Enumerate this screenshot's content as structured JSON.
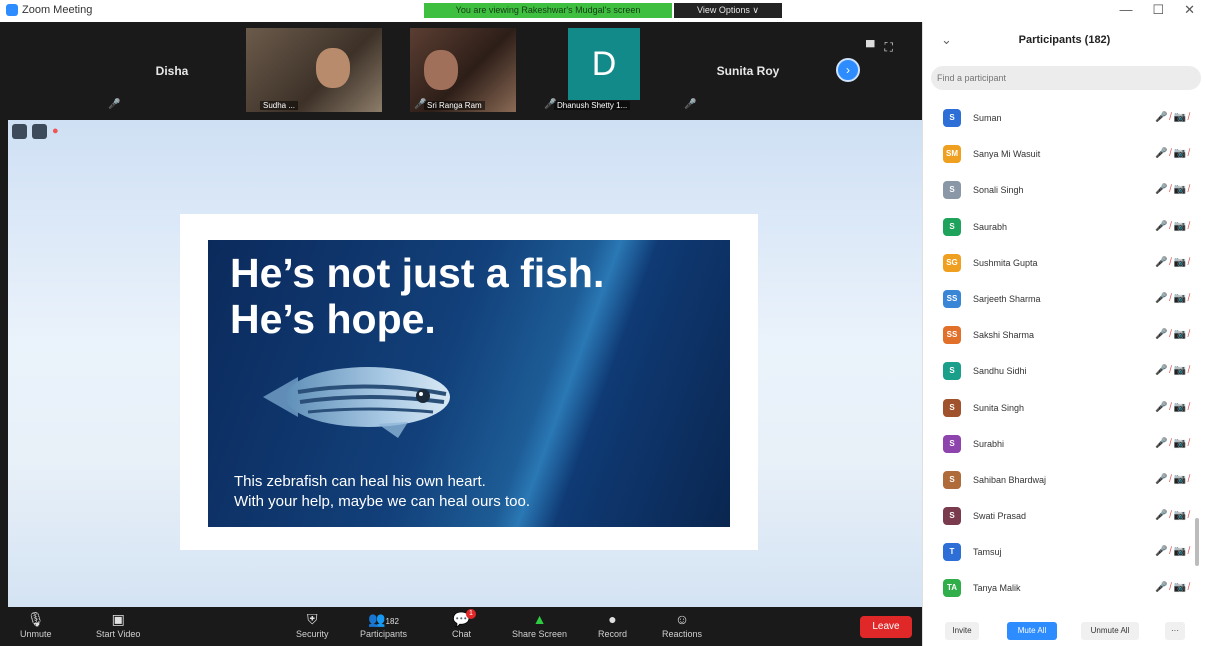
{
  "titlebar": {
    "app_title": "Zoom Meeting",
    "recording_banner": "You are viewing Rakeshwar's Mudgal's screen",
    "view_options": "View Options ∨",
    "window_controls": [
      "—",
      "☐",
      "✕"
    ]
  },
  "gallery": [
    {
      "name": "Disha",
      "type": "name"
    },
    {
      "name": "Sudha ... ",
      "type": "video"
    },
    {
      "name": "Sri Ranga Ram",
      "type": "video"
    },
    {
      "name": "Dhanush Shetty 1...",
      "type": "avatar",
      "initial": "D"
    },
    {
      "name": "Sunita Roy",
      "type": "name"
    }
  ],
  "slide": {
    "headline_1": "He’s not just a fish.",
    "headline_2": "He’s hope.",
    "caption_1": "This zebrafish can heal his own heart.",
    "caption_2": "With your help, maybe we can heal ours too."
  },
  "toolbar": {
    "unmute": "Unmute",
    "start_video": "Start Video",
    "security": "Security",
    "participants": "Participants",
    "participants_count": "182",
    "chat": "Chat",
    "chat_badge": "1",
    "share_screen": "Share Screen",
    "record": "Record",
    "reactions": "Reactions",
    "leave": "Leave"
  },
  "panel": {
    "title": "Participants (182)",
    "search_placeholder": "Find a participant",
    "participants": [
      {
        "name": "Suman",
        "initial": "S",
        "color": "#2d6fd6"
      },
      {
        "name": "Sanya Mi Wasuit",
        "initial": "SM",
        "color": "#f0a020"
      },
      {
        "name": "Sonali Singh",
        "initial": "S",
        "color": "#8a97a6"
      },
      {
        "name": "Saurabh",
        "initial": "S",
        "color": "#1fa35c"
      },
      {
        "name": "Sushmita Gupta",
        "initial": "SG",
        "color": "#f0a020"
      },
      {
        "name": "Sarjeeth Sharma",
        "initial": "SS",
        "color": "#3a86d6"
      },
      {
        "name": "Sakshi Sharma",
        "initial": "SS",
        "color": "#e0702a"
      },
      {
        "name": "Sandhu Sidhi",
        "initial": "S",
        "color": "#1a9f8a"
      },
      {
        "name": "Sunita Singh",
        "initial": "S",
        "color": "#a0522d"
      },
      {
        "name": "Surabhi",
        "initial": "S",
        "color": "#8e44ad"
      },
      {
        "name": "Sahiban Bhardwaj",
        "initial": "S",
        "color": "#b06b3a"
      },
      {
        "name": "Swati Prasad",
        "initial": "S",
        "color": "#7b3b4e"
      },
      {
        "name": "Tamsuj",
        "initial": "T",
        "color": "#2d6fd6"
      },
      {
        "name": "Tanya Malik",
        "initial": "TA",
        "color": "#2fae4a"
      }
    ],
    "invite": "Invite",
    "mute_all": "Mute All",
    "unmute_all": "Unmute All",
    "more": "···"
  }
}
